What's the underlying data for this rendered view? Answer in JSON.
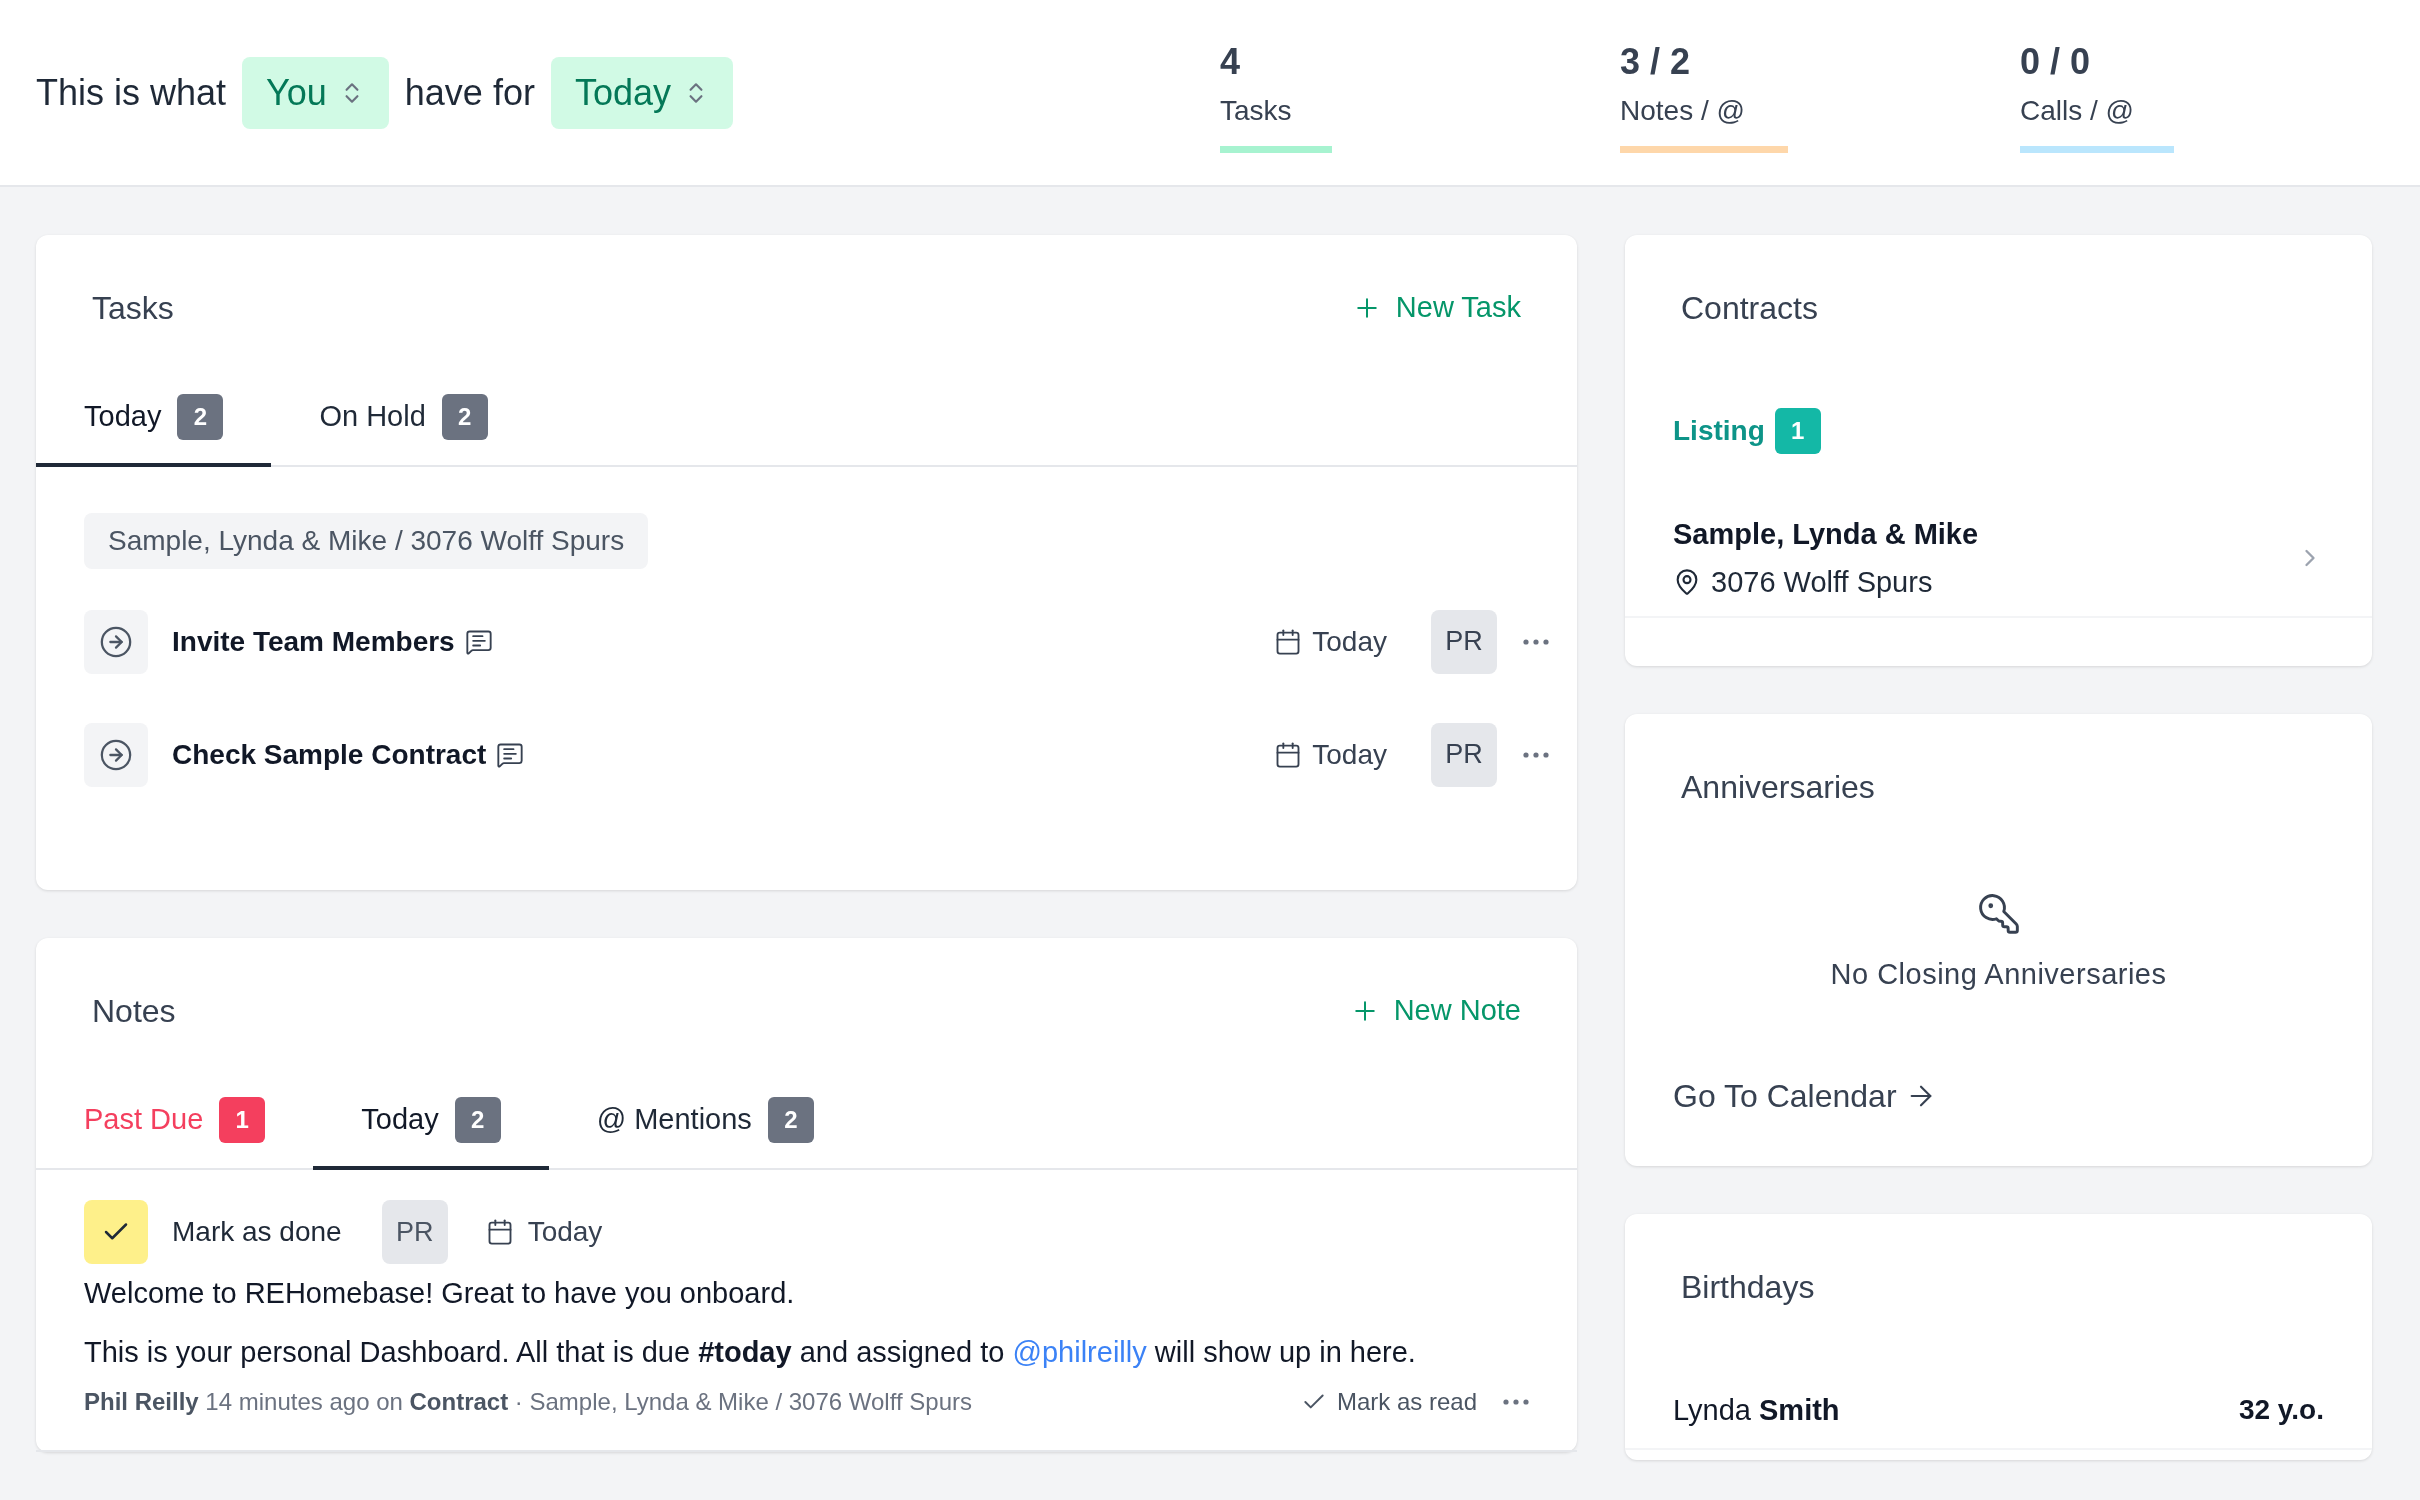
{
  "header": {
    "intro": "This is what",
    "who": "You",
    "connector": "have for",
    "when": "Today"
  },
  "stats": [
    {
      "value": "4",
      "label": "Tasks",
      "color": "#a7f3d0"
    },
    {
      "value": "3 / 2",
      "label": "Notes / @",
      "color": "#fed7aa"
    },
    {
      "value": "0 / 0",
      "label": "Calls / @",
      "color": "#bae6fd"
    }
  ],
  "tasks": {
    "title": "Tasks",
    "new_label": "New Task",
    "tabs": [
      {
        "label": "Today",
        "count": "2",
        "selected": true
      },
      {
        "label": "On Hold",
        "count": "2",
        "selected": false
      }
    ],
    "group": "Sample, Lynda & Mike / 3076 Wolff Spurs",
    "items": [
      {
        "title": "Invite Team Members",
        "due": "Today",
        "assignee": "PR"
      },
      {
        "title": "Check Sample Contract",
        "due": "Today",
        "assignee": "PR"
      }
    ]
  },
  "notes": {
    "title": "Notes",
    "new_label": "New Note",
    "tabs": [
      {
        "label": "Past Due",
        "count": "1",
        "kind": "alert",
        "selected": false
      },
      {
        "label": "Today",
        "count": "2",
        "kind": "normal",
        "selected": true
      },
      {
        "label": "@ Mentions",
        "count": "2",
        "kind": "normal",
        "selected": false
      }
    ],
    "items": [
      {
        "done": false,
        "done_label": "Mark as done",
        "assignee": "PR",
        "due": "Today",
        "lines": [
          "Welcome to REHomebase! Great to have you onboard."
        ],
        "body": {
          "before": "This is your personal Dashboard. All that is due **#today** and assigned to",
          "mention": "@philreilly",
          "after": "will show up in here."
        },
        "meta": "**Phil Reilly** 14 minutes ago on **Contract** · Sample, Lynda & Mike / 3076 Wolff Spurs",
        "read_label": "Mark as read"
      }
    ]
  },
  "contracts": {
    "title": "Contracts",
    "group": "Listing",
    "count": "1",
    "items": [
      {
        "name": "Sample, Lynda & Mike",
        "address": "3076 Wolff Spurs"
      }
    ]
  },
  "anniversaries": {
    "title": "Anniversaries",
    "empty": "No Closing Anniversaries",
    "link": "Go To Calendar"
  },
  "birthdays": {
    "title": "Birthdays",
    "items": [
      {
        "name": "Lynda **Smith**",
        "age": "32 y.o."
      }
    ]
  }
}
